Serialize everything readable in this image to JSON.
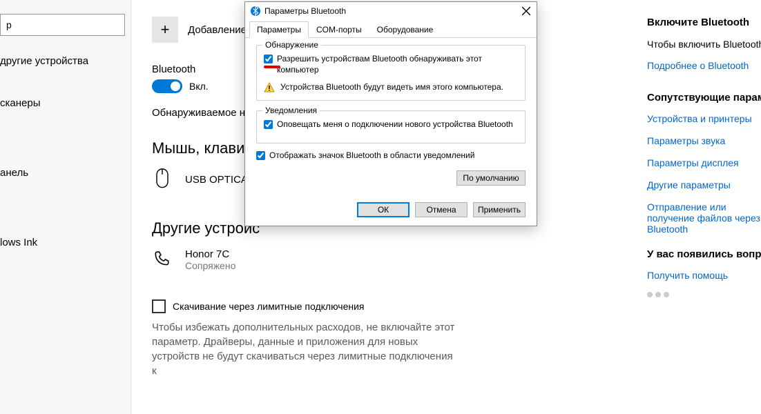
{
  "search": {
    "placeholder": "р"
  },
  "nav": {
    "items": [
      {
        "label": "другие устройства"
      },
      {
        "label": "сканеры"
      },
      {
        "label": "анель"
      },
      {
        "label": "lows Ink"
      }
    ]
  },
  "main": {
    "add_label": "Добавление",
    "bluetooth_label": "Bluetooth",
    "toggle_on": "Вкл.",
    "discoverable": "Обнаруживаемое на",
    "cat_mouse": "Мышь, клавиату",
    "mouse_name": "USB OPTICAL",
    "cat_other": "Другие устройс",
    "phone_name": "Honor 7C",
    "phone_status": "Сопряжено",
    "metered_label": "Скачивание через лимитные подключения",
    "metered_desc": "Чтобы избежать дополнительных расходов, не включайте этот параметр. Драйверы, данные и приложения для новых устройств не будут скачиваться через лимитные подключения к"
  },
  "side": {
    "h1": "Включите Bluetooth",
    "p1": "Чтобы включить Bluetooth, не открывая раздел \"Параметры\", откройте центр уведомлений и выберите значок Bluetooth. Сделайте то же самое, чтобы отключить Bluetooth.",
    "link1": "Подробнее о Bluetooth",
    "h2": "Сопутствующие параметры",
    "links": [
      "Устройства и принтеры",
      "Параметры звука",
      "Параметры дисплея",
      "Другие параметры",
      "Отправление или получение файлов через Bluetooth"
    ],
    "h3": "У вас появились вопросы?",
    "help_link": "Получить помощь"
  },
  "dialog": {
    "title": "Параметры Bluetooth",
    "tabs": [
      "Параметры",
      "COM-порты",
      "Оборудование"
    ],
    "group_discovery": "Обнаружение",
    "chk_allow": "Разрешить устройствам Bluetooth обнаруживать этот компьютер",
    "warn": "Устройства Bluetooth будут видеть имя этого компьютера.",
    "group_notif": "Уведомления",
    "chk_notif": "Оповещать меня о подключении нового устройства Bluetooth",
    "chk_tray": "Отображать значок Bluetooth в области уведомлений",
    "defaults": "По умолчанию",
    "ok": "ОК",
    "cancel": "Отмена",
    "apply": "Применить"
  }
}
